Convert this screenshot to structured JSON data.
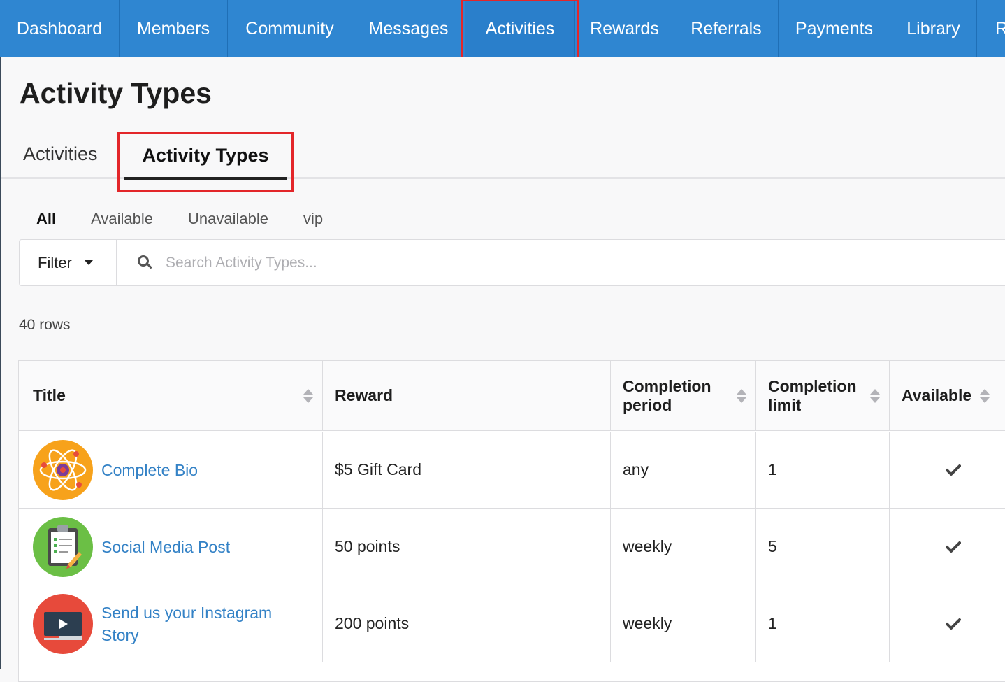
{
  "nav": {
    "items": [
      {
        "label": "Dashboard",
        "width": 171
      },
      {
        "label": "Members",
        "width": 155
      },
      {
        "label": "Community",
        "width": 178
      },
      {
        "label": "Messages",
        "width": 162
      },
      {
        "label": "Activities",
        "width": 157,
        "active": true
      },
      {
        "label": "Rewards",
        "width": 142
      },
      {
        "label": "Referrals",
        "width": 149
      },
      {
        "label": "Payments",
        "width": 160
      },
      {
        "label": "Library",
        "width": 124
      },
      {
        "label": "R",
        "width": 60
      }
    ]
  },
  "page": {
    "title": "Activity Types"
  },
  "tabs": {
    "activities": "Activities",
    "activity_types": "Activity Types"
  },
  "subfilters": [
    "All",
    "Available",
    "Unavailable",
    "vip"
  ],
  "filter": {
    "label": "Filter"
  },
  "search": {
    "placeholder": "Search Activity Types..."
  },
  "rowcount": "40 rows",
  "table": {
    "headers": {
      "title": "Title",
      "reward": "Reward",
      "period": "Completion period",
      "limit": "Completion limit",
      "available": "Available"
    },
    "rows": [
      {
        "title": "Complete Bio",
        "reward": "$5 Gift Card",
        "period": "any",
        "limit": "1",
        "icon": "atom-icon",
        "color": "#f7a21b"
      },
      {
        "title": "Social Media Post",
        "reward": "50 points",
        "period": "weekly",
        "limit": "5",
        "icon": "clipboard-icon",
        "color": "#6bbf45"
      },
      {
        "title": "Send us your Instagram Story",
        "reward": "200 points",
        "period": "weekly",
        "limit": "1",
        "icon": "video-icon",
        "color": "#e74a3b"
      }
    ]
  }
}
